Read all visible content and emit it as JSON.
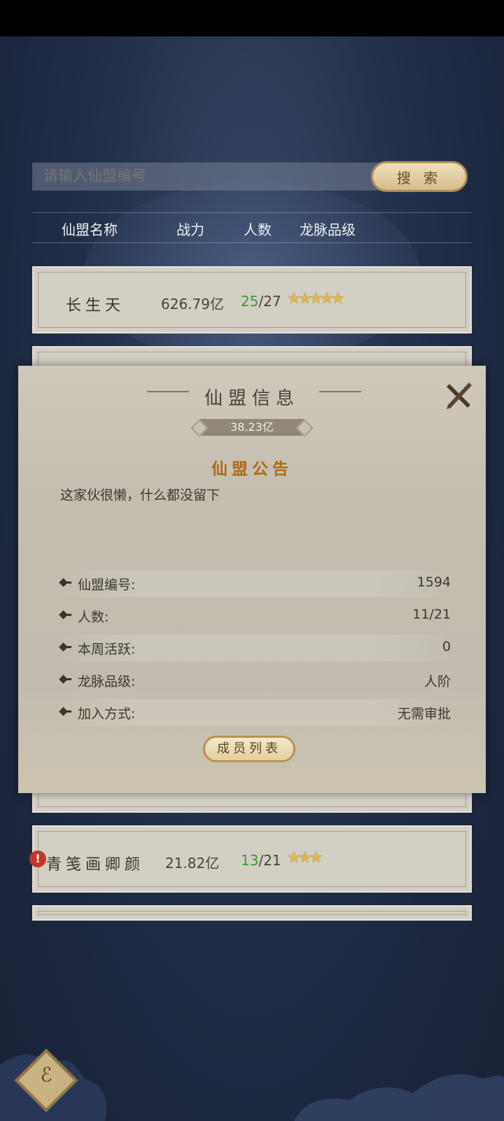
{
  "search": {
    "placeholder": "请输入仙盟编号",
    "button_label": "搜 索"
  },
  "list_header": {
    "col_name": "仙盟名称",
    "col_power": "战力",
    "col_members": "人数",
    "col_rank": "龙脉品级"
  },
  "rows": [
    {
      "name": "长生天",
      "power": "626.79亿",
      "members_current": "25",
      "members_max": "/27",
      "stars": "★★★★★"
    },
    {
      "name": "青笺画卿颜",
      "power": "21.82亿",
      "members_current": "13",
      "members_max": "/21",
      "stars": "★★★"
    }
  ],
  "modal": {
    "title": "仙盟信息",
    "power": "38.23亿",
    "notice_title": "仙盟公告",
    "notice_body": "这家伙很懒，什么都没留下",
    "info": [
      {
        "label": "仙盟编号:",
        "value": "1594"
      },
      {
        "label": "人数:",
        "value": "11/21"
      },
      {
        "label": "本周活跃:",
        "value": "0"
      },
      {
        "label": "龙脉品级:",
        "value": "人阶"
      },
      {
        "label": "加入方式:",
        "value": "无需审批"
      }
    ],
    "member_button": "成员列表"
  },
  "icons": {
    "close": "close-icon",
    "warning": "warning-icon",
    "emblem": "guild-emblem-icon"
  },
  "colors": {
    "accent_gold": "#b06a12",
    "member_green": "#3f9a2f",
    "warning_red": "#c0392b"
  }
}
